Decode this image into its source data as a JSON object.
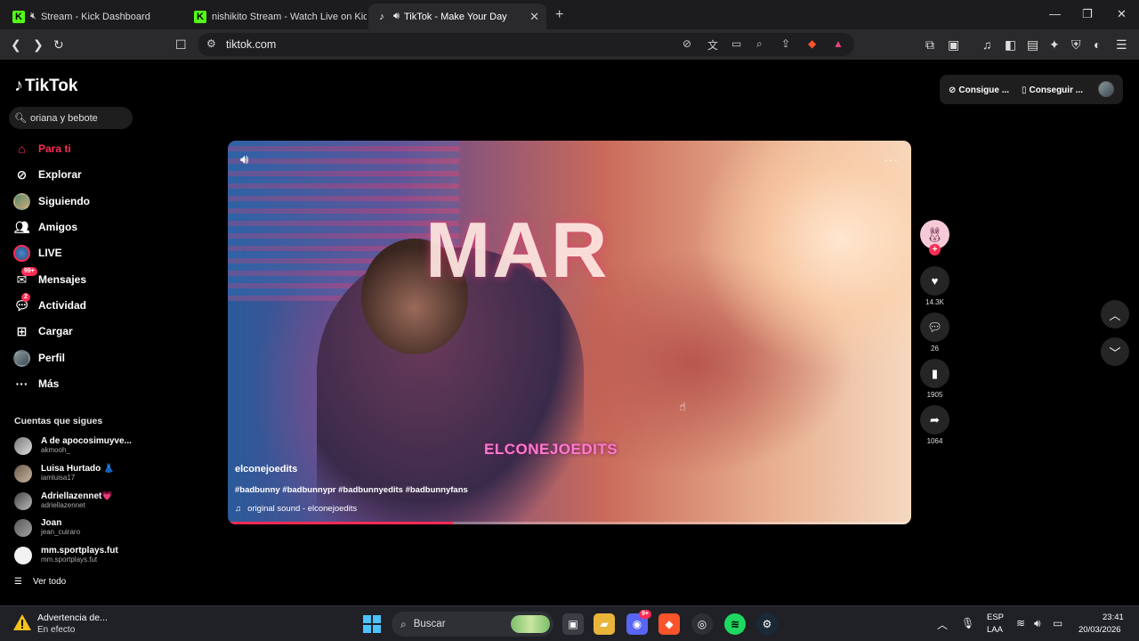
{
  "browser": {
    "tabs": [
      {
        "title": "Stream - Kick Dashboard",
        "favicon": "kick-icon",
        "muted": true
      },
      {
        "title": "nishikito Stream - Watch Live on Kick",
        "favicon": "kick-icon",
        "muted": false
      },
      {
        "title": "TikTok - Make Your Day",
        "favicon": "tiktok-icon",
        "muted": false,
        "playing_audio": true,
        "active": true
      }
    ],
    "url": "tiktok.com"
  },
  "tiktok": {
    "logo_text": "TikTok",
    "search_value": "oriana y bebote",
    "nav": [
      {
        "label": "Para ti",
        "icon": "home-icon",
        "active": true
      },
      {
        "label": "Explorar",
        "icon": "compass-icon"
      },
      {
        "label": "Siguiendo",
        "icon": "following-avatar-icon"
      },
      {
        "label": "Amigos",
        "icon": "friends-icon"
      },
      {
        "label": "LIVE",
        "icon": "live-icon"
      },
      {
        "label": "Mensajes",
        "icon": "messages-icon",
        "badge": "99+"
      },
      {
        "label": "Actividad",
        "icon": "activity-icon",
        "badge": "2"
      },
      {
        "label": "Cargar",
        "icon": "upload-icon"
      },
      {
        "label": "Perfil",
        "icon": "profile-avatar-icon"
      },
      {
        "label": "Más",
        "icon": "more-icon"
      }
    ],
    "following_title": "Cuentas que sigues",
    "following": [
      {
        "name": "A de apocosimuyve...",
        "handle": "akmooh_"
      },
      {
        "name": "Luisa Hurtado 👗",
        "handle": "iamluisa17"
      },
      {
        "name": "Adriellazennet💗",
        "handle": "adriellazennet"
      },
      {
        "name": "Joan",
        "handle": "jean_cuiraro"
      },
      {
        "name": "mm.sportplays.fut",
        "handle": "mm.sportplays.fut"
      }
    ],
    "see_all": "Ver todo",
    "top_buttons": {
      "coins": "Consigue ...",
      "app": "Conseguir ..."
    },
    "video": {
      "overlay_big": "MAR",
      "watermark": "ELCONEJOEDITS",
      "author": "elconejoedits",
      "hashtags": "#badbunny #badbunnypr #badbunnyedits #badbunnyfans",
      "music": "original sound - elconejoedits",
      "progress": 0.33
    },
    "actions": {
      "likes": "14.3K",
      "comments": "26",
      "saves": "1905",
      "shares": "1064"
    }
  },
  "taskbar": {
    "warning_title": "Advertencia de...",
    "warning_sub": "En efecto",
    "search_placeholder": "Buscar",
    "lang_line1": "ESP",
    "lang_line2": "LAA",
    "time": "23:41",
    "date": "20/03/2026",
    "discord_badge": "9+"
  },
  "colors": {
    "accent": "#fe2c55",
    "kick": "#53fc18"
  }
}
